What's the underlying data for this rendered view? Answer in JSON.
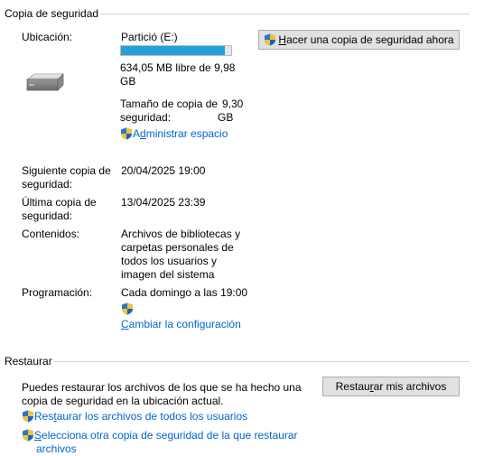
{
  "backup": {
    "section_title": "Copia de seguridad",
    "location_label": "Ubicación:",
    "location_value": "Partició (E:)",
    "disk_used_fraction": 0.94,
    "free_space_line1": "634,05 MB libre de 9,98",
    "free_space_line2": "GB",
    "backup_size_label_l1": "Tamaño de copia de",
    "backup_size_label_l2": "seguridad:",
    "backup_size_value_l1": "9,30",
    "backup_size_value_l2": "GB",
    "manage_space_prefix": "A",
    "manage_space_underlined": "d",
    "manage_space_rest": "ministrar espacio",
    "backup_now_underlined": "H",
    "backup_now_rest": "acer una copia de seguridad ahora",
    "next_backup_label_l1": "Siguiente copia de",
    "next_backup_label_l2": "seguridad:",
    "next_backup_value": "20/04/2025 19:00",
    "last_backup_label_l1": "Última copia de",
    "last_backup_label_l2": "seguridad:",
    "last_backup_value": "13/04/2025 23:39",
    "contents_label": "Contenidos:",
    "contents_l1": "Archivos de bibliotecas y",
    "contents_l2": "carpetas personales de",
    "contents_l3": "todos los usuarios y",
    "contents_l4": "imagen del sistema",
    "schedule_label": "Programación:",
    "schedule_value": "Cada domingo a las 19:00",
    "change_settings_underlined": "C",
    "change_settings_rest": "ambiar la configuración"
  },
  "restore": {
    "section_title": "Restaurar",
    "description_l1": "Puedes restaurar los archivos de los que se ha hecho una",
    "description_l2": "copia de seguridad en la ubicación actual.",
    "restore_button_prefix": "Restau",
    "restore_button_underlined": "r",
    "restore_button_rest": "ar mis archivos",
    "restore_all_prefix": "Res",
    "restore_all_underlined": "t",
    "restore_all_rest": "aurar los archivos de todos los usuarios",
    "select_other_underlined": "S",
    "select_other_rest_l1": "elecciona otra copia de seguridad de la que restaurar",
    "select_other_l2": "archivos"
  },
  "colors": {
    "progress_fill": "#26a0da",
    "link": "#0066cc",
    "button_bg": "#e1e1e1"
  },
  "icons": [
    "drive-icon",
    "shield-icon"
  ]
}
